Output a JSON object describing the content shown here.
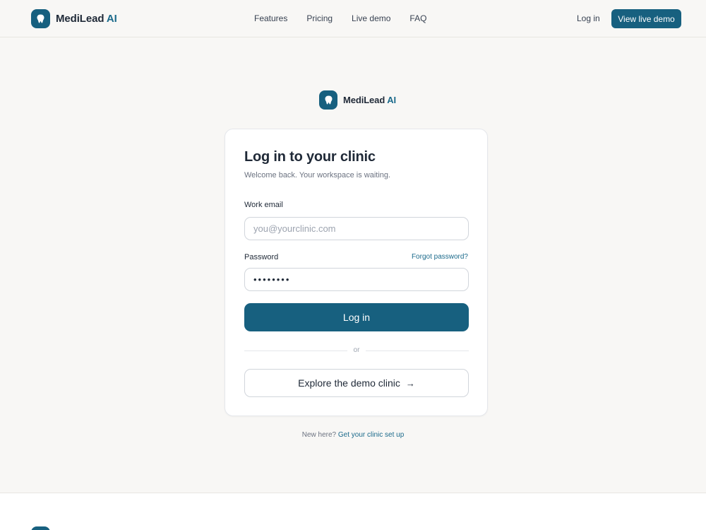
{
  "header": {
    "brand_name": "MediLead",
    "brand_ai": "AI",
    "nav": [
      {
        "label": "Features"
      },
      {
        "label": "Pricing"
      },
      {
        "label": "Live demo"
      },
      {
        "label": "FAQ"
      }
    ],
    "login_label": "Log in",
    "demo_button_label": "View live demo"
  },
  "center_brand": {
    "name": "MediLead",
    "ai": "AI"
  },
  "login_card": {
    "title": "Log in to your clinic",
    "subtitle": "Welcome back. Your workspace is waiting.",
    "email_label": "Work email",
    "email_placeholder": "you@yourclinic.com",
    "email_value": "",
    "password_label": "Password",
    "forgot_label": "Forgot password?",
    "password_value": "password",
    "submit_label": "Log in",
    "divider_text": "or",
    "demo_label": "Explore the demo clinic",
    "demo_arrow": "→"
  },
  "signup": {
    "prompt": "New here?",
    "link": "Get your clinic set up"
  },
  "colors": {
    "brand": "#17607f",
    "background": "#f8f7f5",
    "accent_text": "#1b6a8b"
  },
  "icons": {
    "logo": "tooth-icon",
    "demo_arrow": "arrow-right-icon"
  }
}
